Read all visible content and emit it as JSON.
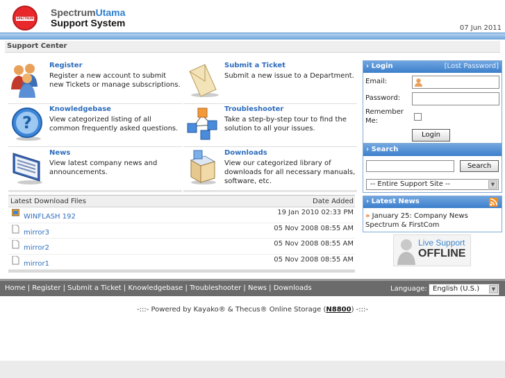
{
  "header": {
    "logo_badge": "SPECTRUM",
    "logo_brand_a": "Spectrum",
    "logo_brand_b": "Utama",
    "logo_subtitle": "Support System",
    "date": "07 Jun 2011"
  },
  "breadcrumb": "Support Center",
  "tiles": [
    {
      "title": "Register",
      "desc": "Register a new account to submit new Tickets or manage subscriptions.",
      "icon": "users-icon"
    },
    {
      "title": "Submit a Ticket",
      "desc": "Submit a new issue to a Department.",
      "icon": "envelope-icon"
    },
    {
      "title": "Knowledgebase",
      "desc": "View categorized listing of all common frequently asked questions.",
      "icon": "question-icon"
    },
    {
      "title": "Troubleshooter",
      "desc": "Take a step-by-step tour to find the solution to all your issues.",
      "icon": "cubes-icon"
    },
    {
      "title": "News",
      "desc": "View latest company news and announcements.",
      "icon": "newspaper-icon"
    },
    {
      "title": "Downloads",
      "desc": "View our categorized library of downloads for all necessary manuals, software, etc.",
      "icon": "box-icon"
    }
  ],
  "downloads": {
    "col_file": "Latest Download Files",
    "col_date": "Date Added",
    "rows": [
      {
        "name": "WINFLASH 192",
        "date": "19 Jan 2010 02:33 PM"
      },
      {
        "name": "mirror3",
        "date": "05 Nov 2008 08:55 AM"
      },
      {
        "name": "mirror2",
        "date": "05 Nov 2008 08:55 AM"
      },
      {
        "name": "mirror1",
        "date": "05 Nov 2008 08:55 AM"
      }
    ]
  },
  "login": {
    "title": "Login",
    "lost_password": "[Lost Password]",
    "email_label": "Email:",
    "password_label": "Password:",
    "remember_label_1": "Remember",
    "remember_label_2": "Me:",
    "button": "Login"
  },
  "search": {
    "title": "Search",
    "button": "Search",
    "scope": "-- Entire Support Site --"
  },
  "news": {
    "title": "Latest News",
    "bullet": "»",
    "item": "January 25: Company News Spectrum & FirstCom"
  },
  "live_support": {
    "line1": "Live Support",
    "line2": "OFFLINE"
  },
  "footer": {
    "links": [
      "Home",
      "Register",
      "Submit a Ticket",
      "Knowledgebase",
      "Troubleshooter",
      "News",
      "Downloads"
    ],
    "separator": " | ",
    "language_label": "Language:",
    "language_value": "English (U.S.)"
  },
  "powered": {
    "prefix": "-:::- Powered by Kayako® & Thecus® Online Storage (",
    "model": "N8800",
    "suffix": ") -:::-"
  },
  "colors": {
    "link_blue": "#2d6cbd",
    "header_blue": "#3c7fcb",
    "logo_red": "#e8282a"
  }
}
